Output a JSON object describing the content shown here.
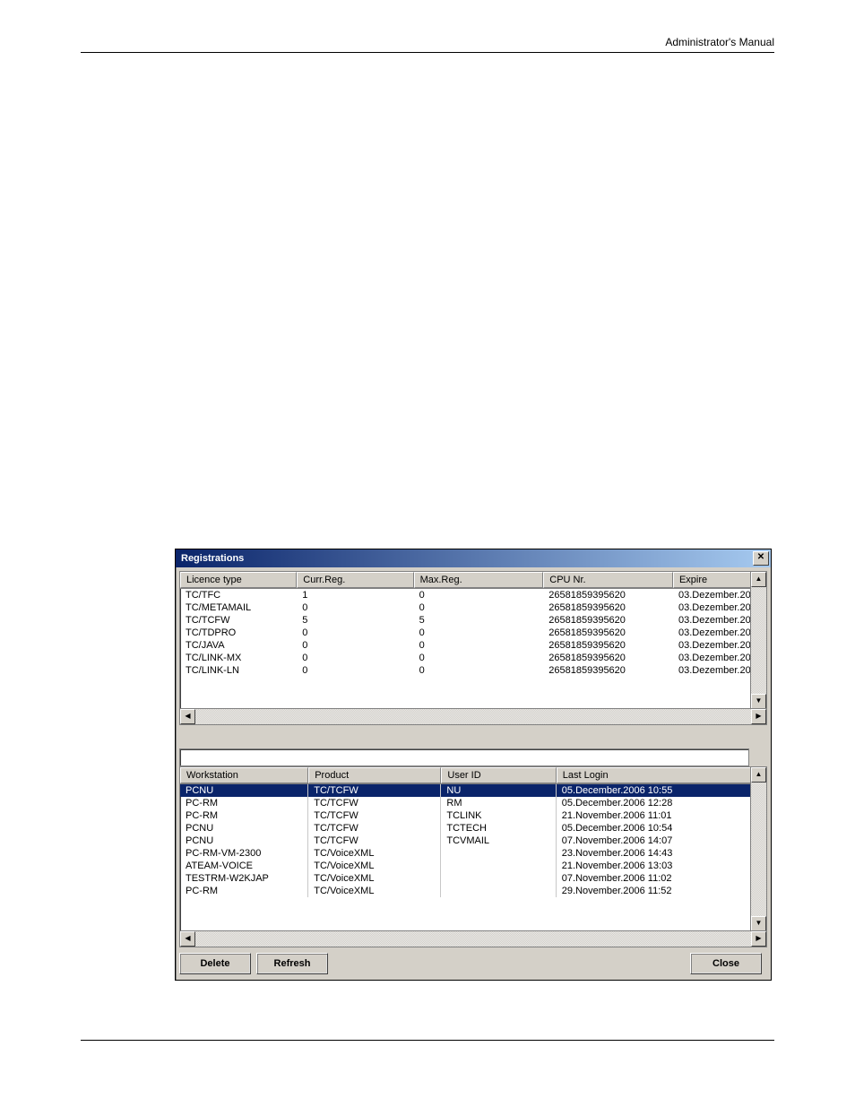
{
  "header": {
    "right": "Administrator's Manual"
  },
  "window": {
    "title": "Registrations",
    "close_glyph": "✕",
    "top_columns": [
      "Licence type",
      "Curr.Reg.",
      "Max.Reg.",
      "CPU Nr.",
      "Expire"
    ],
    "top_rows": [
      {
        "lic": "TC/TFC",
        "curr": "1",
        "max": "0",
        "cpu": "26581859395620",
        "exp": "03.Dezember.20"
      },
      {
        "lic": "TC/METAMAIL",
        "curr": "0",
        "max": "0",
        "cpu": "26581859395620",
        "exp": "03.Dezember.20"
      },
      {
        "lic": "TC/TCFW",
        "curr": "5",
        "max": "5",
        "cpu": "26581859395620",
        "exp": "03.Dezember.20"
      },
      {
        "lic": "TC/TDPRO",
        "curr": "0",
        "max": "0",
        "cpu": "26581859395620",
        "exp": "03.Dezember.20"
      },
      {
        "lic": "TC/JAVA",
        "curr": "0",
        "max": "0",
        "cpu": "26581859395620",
        "exp": "03.Dezember.20"
      },
      {
        "lic": "TC/LINK-MX",
        "curr": "0",
        "max": "0",
        "cpu": "26581859395620",
        "exp": "03.Dezember.20"
      },
      {
        "lic": "TC/LINK-LN",
        "curr": "0",
        "max": "0",
        "cpu": "26581859395620",
        "exp": "03.Dezember.20"
      }
    ],
    "bottom_columns": [
      "Workstation",
      "Product",
      "User ID",
      "Last Login"
    ],
    "bottom_rows": [
      {
        "ws": "PCNU",
        "prod": "TC/TCFW",
        "uid": "NU",
        "login": "05.December.2006   10:55",
        "sel": true
      },
      {
        "ws": "PC-RM",
        "prod": "TC/TCFW",
        "uid": "RM",
        "login": "05.December.2006   12:28"
      },
      {
        "ws": "PC-RM",
        "prod": "TC/TCFW",
        "uid": "TCLINK",
        "login": "21.November.2006   11:01"
      },
      {
        "ws": "PCNU",
        "prod": "TC/TCFW",
        "uid": "TCTECH",
        "login": "05.December.2006   10:54"
      },
      {
        "ws": "PCNU",
        "prod": "TC/TCFW",
        "uid": "TCVMAIL",
        "login": "07.November.2006   14:07"
      },
      {
        "ws": "PC-RM-VM-2300",
        "prod": "TC/VoiceXML",
        "uid": "",
        "login": "23.November.2006   14:43"
      },
      {
        "ws": "ATEAM-VOICE",
        "prod": "TC/VoiceXML",
        "uid": "",
        "login": "21.November.2006   13:03"
      },
      {
        "ws": "TESTRM-W2KJAP",
        "prod": "TC/VoiceXML",
        "uid": "",
        "login": "07.November.2006   11:02"
      },
      {
        "ws": "PC-RM",
        "prod": "TC/VoiceXML",
        "uid": "",
        "login": "29.November.2006   11:52"
      }
    ],
    "buttons": {
      "delete": "Delete",
      "refresh": "Refresh",
      "close": "Close"
    },
    "arrows": {
      "up": "▲",
      "down": "▼",
      "left": "◀",
      "right": "▶"
    }
  }
}
